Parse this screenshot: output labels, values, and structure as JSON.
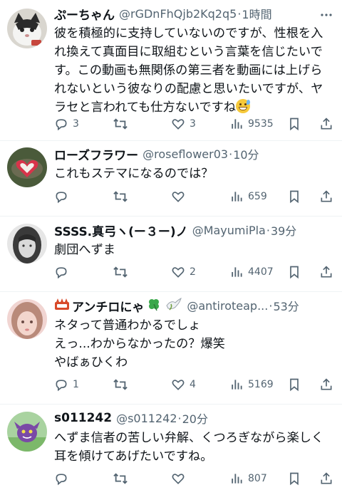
{
  "tweets": [
    {
      "name": "ぷーちゃん",
      "handle": "@rGDnFhQjb2Kq2q5",
      "time": "1時間",
      "lines": [
        "彼を積極的に支持していないのですが、性根を入",
        "れ換えて真面目に取組むという言葉を信じたいで",
        "す。この動画も無関係の第三者を動画には上げら",
        "れないという彼なりの配慮と思いたいですが、ヤ",
        "ラセと言われても仕方ないですね"
      ],
      "emoji": "grinning-sweat-emoji",
      "replies": "3",
      "retweets": "",
      "likes": "3",
      "views": "9535"
    },
    {
      "name": "ローズフラワー",
      "handle": "@roseflower03",
      "time": "10分",
      "lines": [
        "これもステマになるのでは？"
      ],
      "replies": "",
      "retweets": "",
      "likes": "",
      "views": "659"
    },
    {
      "name": "SSSS.真弓ヽ(ー３ー)ノ",
      "handle": "@MayumiPla",
      "time": "39分",
      "lines": [
        "劇団へずま"
      ],
      "replies": "",
      "retweets": "",
      "likes": "2",
      "views": "4407"
    },
    {
      "name": "アンチロにゃ",
      "handle": "@antiroteap...",
      "time": "53分",
      "lines": [
        "ネタって普通わかるでしょ",
        "えっ...わからなかったの？爆笑",
        "やばぁひくわ"
      ],
      "replies": "1",
      "retweets": "",
      "likes": "4",
      "views": "5169"
    },
    {
      "name": "s011242",
      "handle": "@s011242",
      "time": "20分",
      "lines": [
        "へずま信者の苦しい弁解、くつろぎながら楽しく",
        "耳を傾けてあげたいですね。"
      ],
      "replies": "",
      "retweets": "",
      "likes": "",
      "views": "807"
    }
  ],
  "colors": {
    "text": "#0f1419",
    "secondary": "#536471",
    "divider": "#eff3f4"
  },
  "icons": [
    "reply-icon",
    "retweet-icon",
    "like-icon",
    "views-icon",
    "bookmark-icon",
    "share-icon",
    "more-icon"
  ]
}
